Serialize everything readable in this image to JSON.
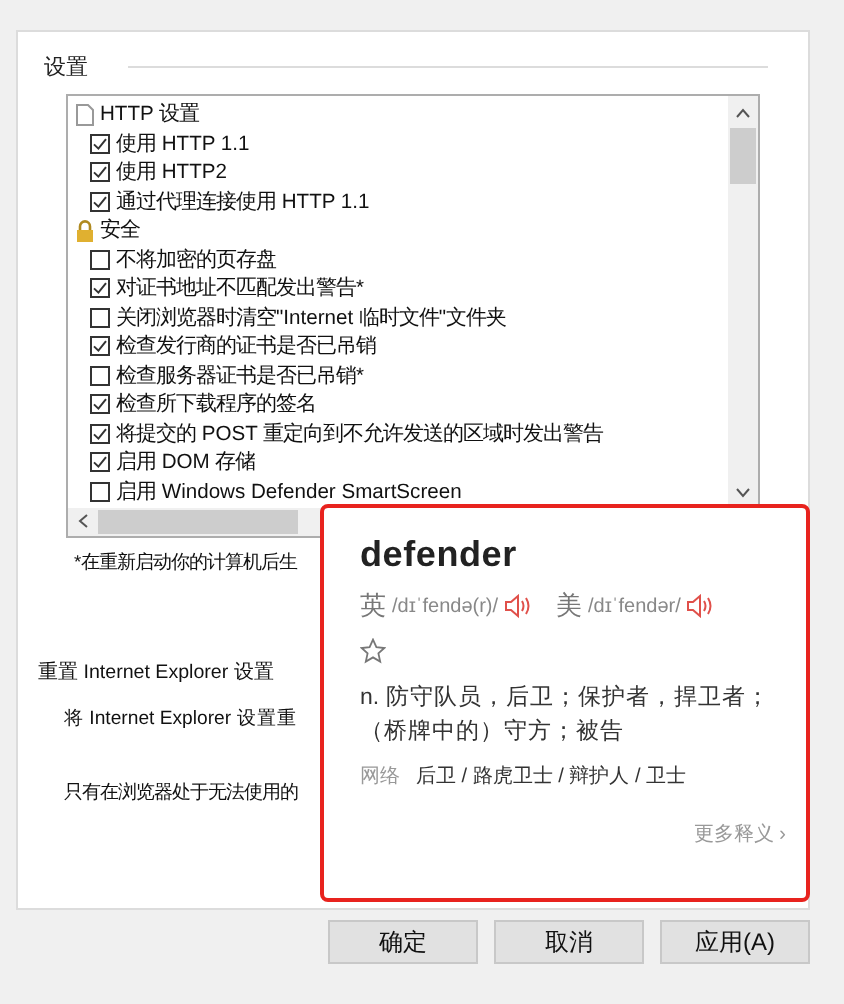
{
  "group_title": "设置",
  "settings": [
    {
      "kind": "page",
      "label": "HTTP 设置"
    },
    {
      "kind": "checkbox",
      "label": "使用 HTTP 1.1",
      "checked": true
    },
    {
      "kind": "checkbox",
      "label": "使用 HTTP2",
      "checked": true
    },
    {
      "kind": "checkbox",
      "label": "通过代理连接使用 HTTP 1.1",
      "checked": true
    },
    {
      "kind": "lock",
      "label": "安全"
    },
    {
      "kind": "checkbox",
      "label": "不将加密的页存盘",
      "checked": false
    },
    {
      "kind": "checkbox",
      "label": "对证书地址不匹配发出警告*",
      "checked": true
    },
    {
      "kind": "checkbox",
      "label": "关闭浏览器时清空\"Internet 临时文件\"文件夹",
      "checked": false
    },
    {
      "kind": "checkbox",
      "label": "检查发行商的证书是否已吊销",
      "checked": true
    },
    {
      "kind": "checkbox",
      "label": "检查服务器证书是否已吊销*",
      "checked": false
    },
    {
      "kind": "checkbox",
      "label": "检查所下载程序的签名",
      "checked": true
    },
    {
      "kind": "checkbox",
      "label": "将提交的 POST 重定向到不允许发送的区域时发出警告",
      "checked": true
    },
    {
      "kind": "checkbox",
      "label": "启用 DOM 存储",
      "checked": true
    },
    {
      "kind": "checkbox",
      "label": "启用 Windows Defender SmartScreen",
      "checked": false
    }
  ],
  "footnote": "*在重新启动你的计算机后生",
  "reset": {
    "title": "重置 Internet Explorer 设置",
    "text": "将 Internet Explorer 设置重",
    "note": "只有在浏览器处于无法使用的"
  },
  "popup": {
    "word": "defender",
    "pronunciations": [
      {
        "region": "英",
        "phonetic": "/dɪˈfendə(r)/"
      },
      {
        "region": "美",
        "phonetic": "/dɪˈfendər/"
      }
    ],
    "definition": "n. 防守队员，后卫；保护者，捍卫者；（桥牌中的）守方；被告",
    "web_label": "网络",
    "web_terms": "后卫 / 路虎卫士 / 辩护人 / 卫士",
    "more": "更多释义 ›"
  },
  "buttons": [
    "确定",
    "取消",
    "应用(A)"
  ]
}
